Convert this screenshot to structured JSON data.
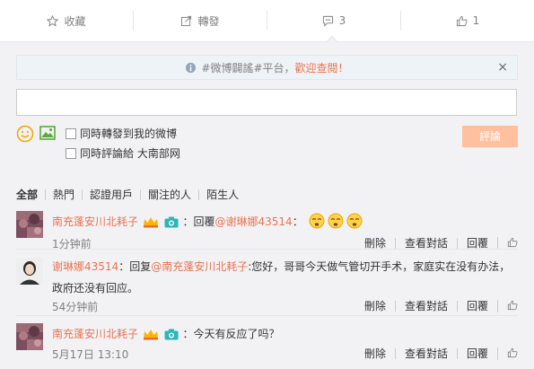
{
  "actions": {
    "favorite": "收藏",
    "repost": "轉發",
    "comment_count": "3",
    "like_count": "1"
  },
  "topic_bar": {
    "hashtags": "#微博闢謠#平台，",
    "link": "歡迎查閱！",
    "close": "×"
  },
  "compose": {
    "input_value": "",
    "opt_repost": "同時轉發到我的微博",
    "opt_comment": "同時評論給 大南部网",
    "submit": "評論"
  },
  "filters": [
    "全部",
    "熱門",
    "認證用戶",
    "關注的人",
    "陌生人"
  ],
  "comments": [
    {
      "user": "南充蓬安川北耗子",
      "text_prefix": "：回覆",
      "mention": "@谢琳娜43514",
      "text_suffix": "：",
      "time": "1分钟前",
      "actions": [
        "刪除",
        "查看對話",
        "回覆"
      ]
    },
    {
      "user": "谢琳娜43514",
      "text_prefix": "：回复",
      "mention": "@南充蓬安川北耗子",
      "text_suffix": ":您好，哥哥今天做气管切开手术，家庭实在没有办法，政府还没有回应。",
      "time": "54分钟前",
      "actions": [
        "刪除",
        "查看對話",
        "回覆"
      ]
    },
    {
      "user": "南充蓬安川北耗子",
      "text_prefix": "：今天有反应了吗？",
      "mention": "",
      "text_suffix": "",
      "time": "5月17日 13:10",
      "actions": [
        "刪除",
        "查看對話",
        "回覆"
      ]
    }
  ],
  "colors": {
    "accent": "#eb7350",
    "panel_bg": "#f2f2f5",
    "submit_disabled": "#ffc09f"
  }
}
